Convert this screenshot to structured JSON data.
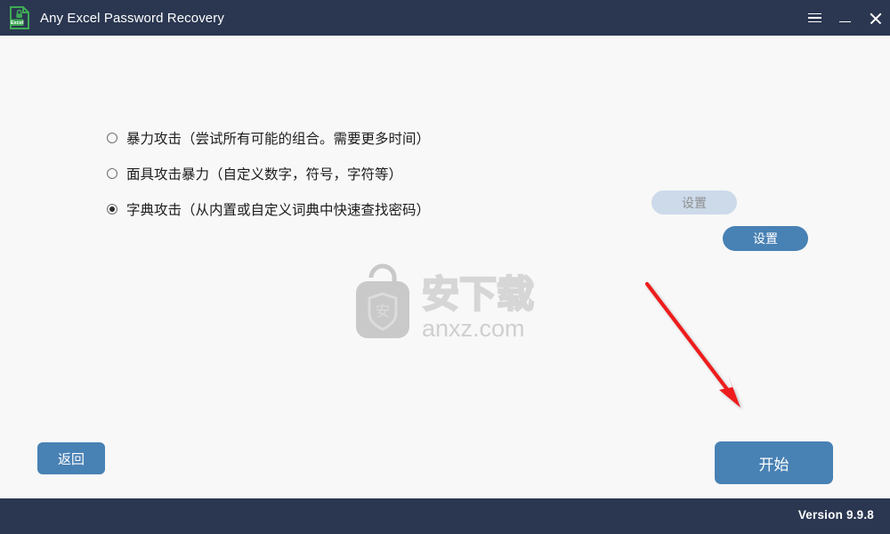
{
  "window": {
    "title": "Any Excel Password Recovery",
    "app_icon": "excel-lock-document-icon",
    "controls": {
      "menu": "menu-hamburger-icon",
      "minimize": "minimize-icon",
      "close": "close-icon"
    }
  },
  "attack_options": [
    {
      "id": "brute-force",
      "label": "暴力攻击（尝试所有可能的组合。需要更多时间）",
      "selected": false
    },
    {
      "id": "mask-brute-force",
      "label": "面具攻击暴力（自定义数字，符号，字符等）",
      "selected": false
    },
    {
      "id": "dictionary",
      "label": "字典攻击（从内置或自定义词典中快速查找密码）",
      "selected": true
    }
  ],
  "settings_buttons": {
    "disabled_label": "设置",
    "active_label": "设置"
  },
  "actions": {
    "back_label": "返回",
    "start_label": "开始"
  },
  "watermark": {
    "logo_text": "安下载",
    "domain_text": "anxz.com",
    "shield_char": "安"
  },
  "footer": {
    "version": "Version 9.9.8"
  },
  "colors": {
    "titlebar": "#2b3751",
    "accent_blue": "#4881b4",
    "disabled_blue": "#ccdaea",
    "background": "#f8f8f8",
    "annotation_red": "#ee1b1b",
    "excel_green": "#3faa55"
  }
}
